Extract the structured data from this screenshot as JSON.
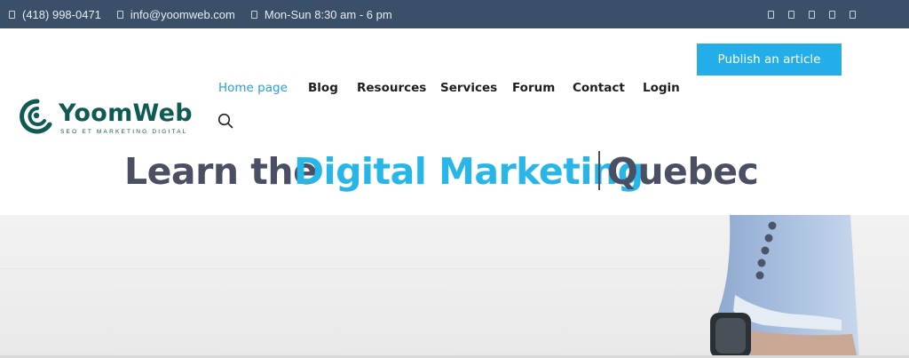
{
  "topbar": {
    "phone": "(418) 998-0471",
    "email": "info@yoomweb.com",
    "hours": "Mon-Sun 8:30 am - 6 pm",
    "background": "#3a5068"
  },
  "logo": {
    "name": "YoomWeb",
    "tagline": "SEO ET MARKETING DIGITAL",
    "color": "#0f5a52"
  },
  "nav": {
    "items": [
      {
        "label": "Home page",
        "active": true
      },
      {
        "label": "Blog",
        "active": false
      },
      {
        "label": "Resources",
        "active": false
      },
      {
        "label": "Services",
        "active": false
      },
      {
        "label": "Forum",
        "active": false
      },
      {
        "label": "Contact",
        "active": false
      },
      {
        "label": "Login",
        "active": false
      }
    ],
    "active_color": "#2a9fd6",
    "publish_label": "Publish an article",
    "publish_color": "#24aee9",
    "search_icon": "search-icon"
  },
  "headline": {
    "part1": "Learn the",
    "part2": "Digital Marketing",
    "part3": "Quebec",
    "accent": "#28b6e8",
    "dark": "#4a4f63"
  }
}
